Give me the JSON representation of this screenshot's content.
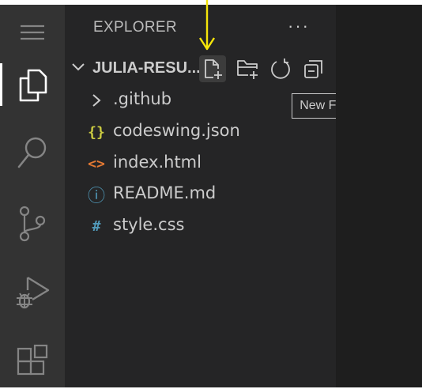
{
  "explorer": {
    "title": "EXPLORER",
    "more_label": "···",
    "folder_name": "JULIA-RESU...",
    "tooltip": "New File..."
  },
  "files": [
    {
      "name": ".github",
      "icon": "chevron-right-icon",
      "icon_text": "",
      "icon_color": "#cccccc"
    },
    {
      "name": "codeswing.json",
      "icon": "json-braces-icon",
      "icon_text": "{}",
      "icon_color": "#cbcb41"
    },
    {
      "name": "index.html",
      "icon": "html-angle-icon",
      "icon_text": "<>",
      "icon_color": "#e37933"
    },
    {
      "name": "README.md",
      "icon": "info-icon",
      "icon_text": "ⓘ",
      "icon_color": "#519aba"
    },
    {
      "name": "style.css",
      "icon": "css-hash-icon",
      "icon_text": "#",
      "icon_color": "#519aba"
    }
  ],
  "colors": {
    "activity_bar": "#333333",
    "sidebar": "#252526",
    "editor": "#1e1e1e",
    "annotation_arrow": "#f5e50a"
  }
}
